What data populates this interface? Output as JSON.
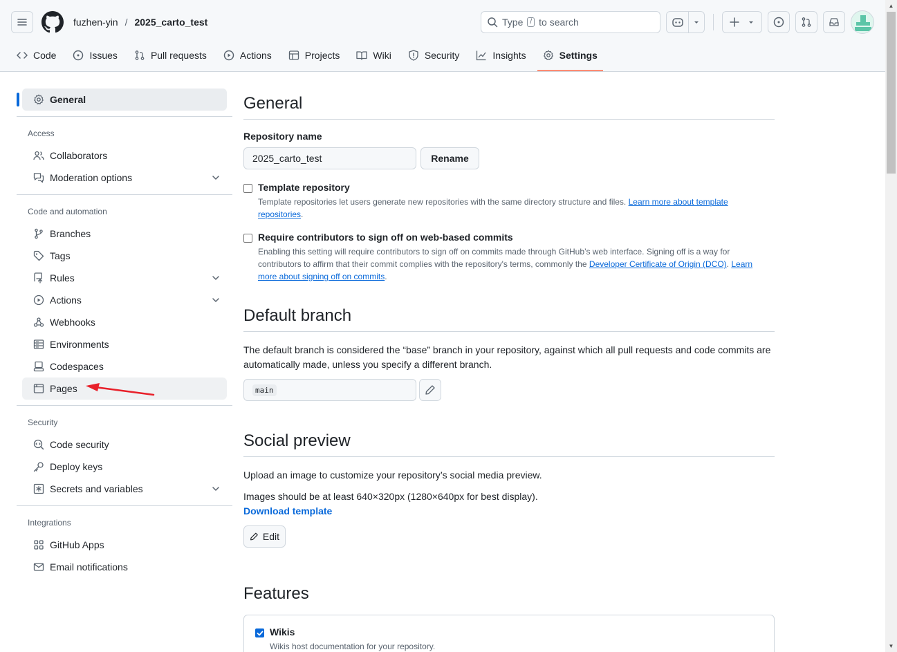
{
  "header": {
    "owner": "fuzhen-yin",
    "separator": "/",
    "repo": "2025_carto_test",
    "search": {
      "prefix": "Type",
      "key": "/",
      "suffix": "to search"
    }
  },
  "tabs": [
    {
      "label": "Code",
      "icon": "code-icon"
    },
    {
      "label": "Issues",
      "icon": "issue-icon"
    },
    {
      "label": "Pull requests",
      "icon": "pull-request-icon"
    },
    {
      "label": "Actions",
      "icon": "play-icon"
    },
    {
      "label": "Projects",
      "icon": "table-icon"
    },
    {
      "label": "Wiki",
      "icon": "book-icon"
    },
    {
      "label": "Security",
      "icon": "shield-icon"
    },
    {
      "label": "Insights",
      "icon": "graph-icon"
    },
    {
      "label": "Settings",
      "icon": "gear-icon",
      "selected": true
    }
  ],
  "sidebar": {
    "general": "General",
    "groups": [
      {
        "title": "Access",
        "items": [
          {
            "label": "Collaborators",
            "icon": "people-icon"
          },
          {
            "label": "Moderation options",
            "icon": "comment-discussion-icon",
            "expandable": true
          }
        ]
      },
      {
        "title": "Code and automation",
        "items": [
          {
            "label": "Branches",
            "icon": "git-branch-icon"
          },
          {
            "label": "Tags",
            "icon": "tag-icon"
          },
          {
            "label": "Rules",
            "icon": "repo-push-icon",
            "expandable": true
          },
          {
            "label": "Actions",
            "icon": "play-icon",
            "expandable": true
          },
          {
            "label": "Webhooks",
            "icon": "webhook-icon"
          },
          {
            "label": "Environments",
            "icon": "server-icon"
          },
          {
            "label": "Codespaces",
            "icon": "codespaces-icon"
          },
          {
            "label": "Pages",
            "icon": "browser-icon",
            "hover": true
          }
        ]
      },
      {
        "title": "Security",
        "items": [
          {
            "label": "Code security",
            "icon": "codescan-icon"
          },
          {
            "label": "Deploy keys",
            "icon": "key-icon"
          },
          {
            "label": "Secrets and variables",
            "icon": "key-asterisk-icon",
            "expandable": true
          }
        ]
      },
      {
        "title": "Integrations",
        "items": [
          {
            "label": "GitHub Apps",
            "icon": "apps-icon"
          },
          {
            "label": "Email notifications",
            "icon": "mail-icon"
          }
        ]
      }
    ]
  },
  "main": {
    "general_title": "General",
    "repo_name_label": "Repository name",
    "repo_name_value": "2025_carto_test",
    "rename_button": "Rename",
    "template": {
      "title": "Template repository",
      "desc": "Template repositories let users generate new repositories with the same directory structure and files.",
      "link": "Learn more about template repositories",
      "end": "."
    },
    "signoff": {
      "title": "Require contributors to sign off on web-based commits",
      "desc": "Enabling this setting will require contributors to sign off on commits made through GitHub’s web interface. Signing off is a way for contributors to affirm that their commit complies with the repository's terms, commonly the",
      "link1": "Developer Certificate of Origin (DCO)",
      "mid": ".",
      "link2": "Learn more about signing off on commits",
      "end": "."
    },
    "default_branch_title": "Default branch",
    "default_branch_desc": "The default branch is considered the “base” branch in your repository, against which all pull requests and code commits are automatically made, unless you specify a different branch.",
    "default_branch_value": "main",
    "social_title": "Social preview",
    "social_desc1": "Upload an image to customize your repository’s social media preview.",
    "social_desc2": "Images should be at least 640×320px (1280×640px for best display).",
    "download_template": "Download template",
    "edit_button": "Edit",
    "features_title": "Features",
    "wikis": {
      "title": "Wikis",
      "desc": "Wikis host documentation for your repository.",
      "checked": true
    }
  },
  "colors": {
    "accent": "#0969da",
    "tab_underline": "#fd8c73",
    "annotation_arrow": "#e8202a"
  }
}
